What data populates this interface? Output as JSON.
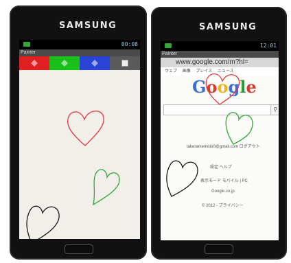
{
  "left_phone": {
    "brand": "SAMSUNG",
    "status_time": "00:08",
    "app_title": "Painter",
    "palette": [
      {
        "name": "red",
        "color": "#e02020"
      },
      {
        "name": "green",
        "color": "#18c018"
      },
      {
        "name": "blue",
        "color": "#2a44d8"
      },
      {
        "name": "white",
        "color": "#5a5a5a"
      }
    ],
    "drawings": [
      "red heart",
      "green heart",
      "black heart"
    ]
  },
  "right_phone": {
    "brand": "SAMSUNG",
    "status_time": "12:01",
    "app_title": "Painter",
    "url": "www.google.com/m?hl=",
    "tabs": [
      "ウェブ",
      "画像",
      "プレイス",
      "ニュース"
    ],
    "logo": "Google",
    "account_line": "takeramemoto0@gmail.com ログアウト",
    "links_row": "設定 ヘルプ",
    "mode_row": "表示モード モバイル | PC",
    "domain_link": "Google.co.jp",
    "copyright": "© 2012 - プライバシー"
  },
  "colors": {
    "heart_red": "#e23a3a",
    "heart_green": "#2aa832",
    "heart_black": "#1a1a1a"
  }
}
